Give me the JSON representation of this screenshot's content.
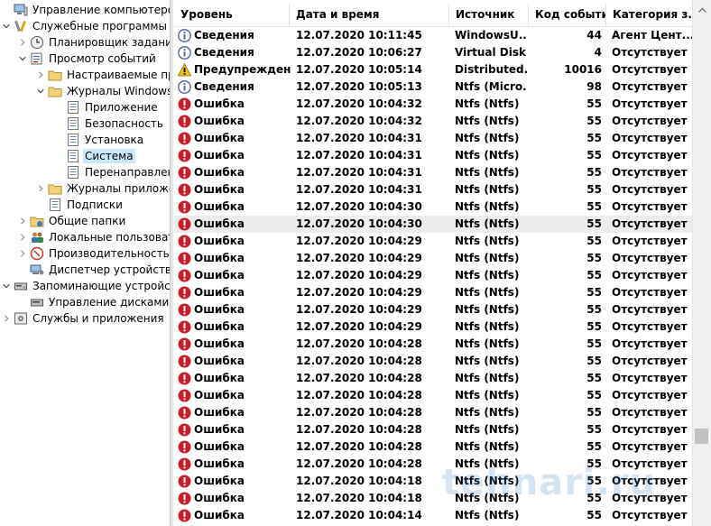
{
  "tree": [
    {
      "label": "Управление компьютером (л",
      "level": 0,
      "expand": "none",
      "icon": "computer-icon",
      "name": "tree-item-computer-management"
    },
    {
      "label": "Служебные программы",
      "level": 0,
      "expand": "open",
      "icon": "tools-icon",
      "name": "tree-item-system-tools"
    },
    {
      "label": "Планировщик заданий",
      "level": 1,
      "expand": "closed",
      "icon": "clock-icon",
      "name": "tree-item-task-scheduler"
    },
    {
      "label": "Просмотр событий",
      "level": 1,
      "expand": "open",
      "icon": "event-viewer-icon",
      "name": "tree-item-event-viewer"
    },
    {
      "label": "Настраиваемые пр",
      "level": 2,
      "expand": "closed",
      "icon": "folder-icon",
      "name": "tree-item-custom-views"
    },
    {
      "label": "Журналы Windows",
      "level": 2,
      "expand": "open",
      "icon": "folder-icon",
      "name": "tree-item-windows-logs"
    },
    {
      "label": "Приложение",
      "level": 3,
      "expand": "none",
      "icon": "log-icon",
      "name": "tree-item-application"
    },
    {
      "label": "Безопасность",
      "level": 3,
      "expand": "none",
      "icon": "log-icon",
      "name": "tree-item-security"
    },
    {
      "label": "Установка",
      "level": 3,
      "expand": "none",
      "icon": "log-icon",
      "name": "tree-item-setup"
    },
    {
      "label": "Система",
      "level": 3,
      "expand": "none",
      "icon": "log-icon",
      "name": "tree-item-system",
      "selected": true
    },
    {
      "label": "Перенаправлен",
      "level": 3,
      "expand": "none",
      "icon": "log-icon",
      "name": "tree-item-forwarded"
    },
    {
      "label": "Журналы приложе",
      "level": 2,
      "expand": "closed",
      "icon": "folder-icon",
      "name": "tree-item-app-logs"
    },
    {
      "label": "Подписки",
      "level": 2,
      "expand": "none",
      "icon": "log-icon",
      "name": "tree-item-subscriptions"
    },
    {
      "label": "Общие папки",
      "level": 1,
      "expand": "closed",
      "icon": "shared-folder-icon",
      "name": "tree-item-shared-folders"
    },
    {
      "label": "Локальные пользовате",
      "level": 1,
      "expand": "closed",
      "icon": "users-icon",
      "name": "tree-item-local-users"
    },
    {
      "label": "Производительность",
      "level": 1,
      "expand": "closed",
      "icon": "performance-icon",
      "name": "tree-item-performance"
    },
    {
      "label": "Диспетчер устройств",
      "level": 1,
      "expand": "none",
      "icon": "device-manager-icon",
      "name": "tree-item-device-manager"
    },
    {
      "label": "Запоминающие устройств",
      "level": 0,
      "expand": "open",
      "icon": "storage-icon",
      "name": "tree-item-storage"
    },
    {
      "label": "Управление дисками",
      "level": 1,
      "expand": "none",
      "icon": "disk-icon",
      "name": "tree-item-disk-management"
    },
    {
      "label": "Службы и приложения",
      "level": 0,
      "expand": "closed",
      "icon": "services-icon",
      "name": "tree-item-services"
    }
  ],
  "columns": {
    "level": "Уровень",
    "date": "Дата и время",
    "source": "Источник",
    "code": "Код события",
    "category": "Категория з..."
  },
  "rows": [
    {
      "type": "info",
      "level": "Сведения",
      "date": "12.07.2020 10:11:45",
      "source": "WindowsU...",
      "code": "44",
      "category": "Агент Цент..."
    },
    {
      "type": "info",
      "level": "Сведения",
      "date": "12.07.2020 10:06:27",
      "source": "Virtual Disk...",
      "code": "4",
      "category": "Отсутствует"
    },
    {
      "type": "warning",
      "level": "Предупреждение",
      "date": "12.07.2020 10:05:14",
      "source": "Distributed...",
      "code": "10016",
      "category": "Отсутствует"
    },
    {
      "type": "info",
      "level": "Сведения",
      "date": "12.07.2020 10:05:13",
      "source": "Ntfs (Micro...",
      "code": "98",
      "category": "Отсутствует"
    },
    {
      "type": "error",
      "level": "Ошибка",
      "date": "12.07.2020 10:04:32",
      "source": "Ntfs (Ntfs)",
      "code": "55",
      "category": "Отсутствует"
    },
    {
      "type": "error",
      "level": "Ошибка",
      "date": "12.07.2020 10:04:32",
      "source": "Ntfs (Ntfs)",
      "code": "55",
      "category": "Отсутствует"
    },
    {
      "type": "error",
      "level": "Ошибка",
      "date": "12.07.2020 10:04:31",
      "source": "Ntfs (Ntfs)",
      "code": "55",
      "category": "Отсутствует"
    },
    {
      "type": "error",
      "level": "Ошибка",
      "date": "12.07.2020 10:04:31",
      "source": "Ntfs (Ntfs)",
      "code": "55",
      "category": "Отсутствует"
    },
    {
      "type": "error",
      "level": "Ошибка",
      "date": "12.07.2020 10:04:31",
      "source": "Ntfs (Ntfs)",
      "code": "55",
      "category": "Отсутствует"
    },
    {
      "type": "error",
      "level": "Ошибка",
      "date": "12.07.2020 10:04:31",
      "source": "Ntfs (Ntfs)",
      "code": "55",
      "category": "Отсутствует"
    },
    {
      "type": "error",
      "level": "Ошибка",
      "date": "12.07.2020 10:04:30",
      "source": "Ntfs (Ntfs)",
      "code": "55",
      "category": "Отсутствует"
    },
    {
      "type": "error",
      "level": "Ошибка",
      "date": "12.07.2020 10:04:30",
      "source": "Ntfs (Ntfs)",
      "code": "55",
      "category": "Отсутствует",
      "highlight": true
    },
    {
      "type": "error",
      "level": "Ошибка",
      "date": "12.07.2020 10:04:29",
      "source": "Ntfs (Ntfs)",
      "code": "55",
      "category": "Отсутствует"
    },
    {
      "type": "error",
      "level": "Ошибка",
      "date": "12.07.2020 10:04:29",
      "source": "Ntfs (Ntfs)",
      "code": "55",
      "category": "Отсутствует"
    },
    {
      "type": "error",
      "level": "Ошибка",
      "date": "12.07.2020 10:04:29",
      "source": "Ntfs (Ntfs)",
      "code": "55",
      "category": "Отсутствует"
    },
    {
      "type": "error",
      "level": "Ошибка",
      "date": "12.07.2020 10:04:29",
      "source": "Ntfs (Ntfs)",
      "code": "55",
      "category": "Отсутствует"
    },
    {
      "type": "error",
      "level": "Ошибка",
      "date": "12.07.2020 10:04:29",
      "source": "Ntfs (Ntfs)",
      "code": "55",
      "category": "Отсутствует"
    },
    {
      "type": "error",
      "level": "Ошибка",
      "date": "12.07.2020 10:04:29",
      "source": "Ntfs (Ntfs)",
      "code": "55",
      "category": "Отсутствует"
    },
    {
      "type": "error",
      "level": "Ошибка",
      "date": "12.07.2020 10:04:28",
      "source": "Ntfs (Ntfs)",
      "code": "55",
      "category": "Отсутствует"
    },
    {
      "type": "error",
      "level": "Ошибка",
      "date": "12.07.2020 10:04:28",
      "source": "Ntfs (Ntfs)",
      "code": "55",
      "category": "Отсутствует"
    },
    {
      "type": "error",
      "level": "Ошибка",
      "date": "12.07.2020 10:04:28",
      "source": "Ntfs (Ntfs)",
      "code": "55",
      "category": "Отсутствует"
    },
    {
      "type": "error",
      "level": "Ошибка",
      "date": "12.07.2020 10:04:28",
      "source": "Ntfs (Ntfs)",
      "code": "55",
      "category": "Отсутствует"
    },
    {
      "type": "error",
      "level": "Ошибка",
      "date": "12.07.2020 10:04:28",
      "source": "Ntfs (Ntfs)",
      "code": "55",
      "category": "Отсутствует"
    },
    {
      "type": "error",
      "level": "Ошибка",
      "date": "12.07.2020 10:04:28",
      "source": "Ntfs (Ntfs)",
      "code": "55",
      "category": "Отсутствует"
    },
    {
      "type": "error",
      "level": "Ошибка",
      "date": "12.07.2020 10:04:28",
      "source": "Ntfs (Ntfs)",
      "code": "55",
      "category": "Отсутствует"
    },
    {
      "type": "error",
      "level": "Ошибка",
      "date": "12.07.2020 10:04:28",
      "source": "Ntfs (Ntfs)",
      "code": "55",
      "category": "Отсутствует"
    },
    {
      "type": "error",
      "level": "Ошибка",
      "date": "12.07.2020 10:04:18",
      "source": "Ntfs (Ntfs)",
      "code": "55",
      "category": "Отсутствует"
    },
    {
      "type": "error",
      "level": "Ошибка",
      "date": "12.07.2020 10:04:18",
      "source": "Ntfs (Ntfs)",
      "code": "55",
      "category": "Отсутствует"
    },
    {
      "type": "error",
      "level": "Ошибка",
      "date": "12.07.2020 10:04:14",
      "source": "Ntfs (Ntfs)",
      "code": "55",
      "category": "Отсутствует"
    }
  ],
  "watermark": "tehnari.ru",
  "colors": {
    "error": "#c81e2a",
    "info": "#4a5fa8",
    "warning": "#f2c012",
    "selection": "#cce8ff",
    "highlight": "#ececec"
  }
}
